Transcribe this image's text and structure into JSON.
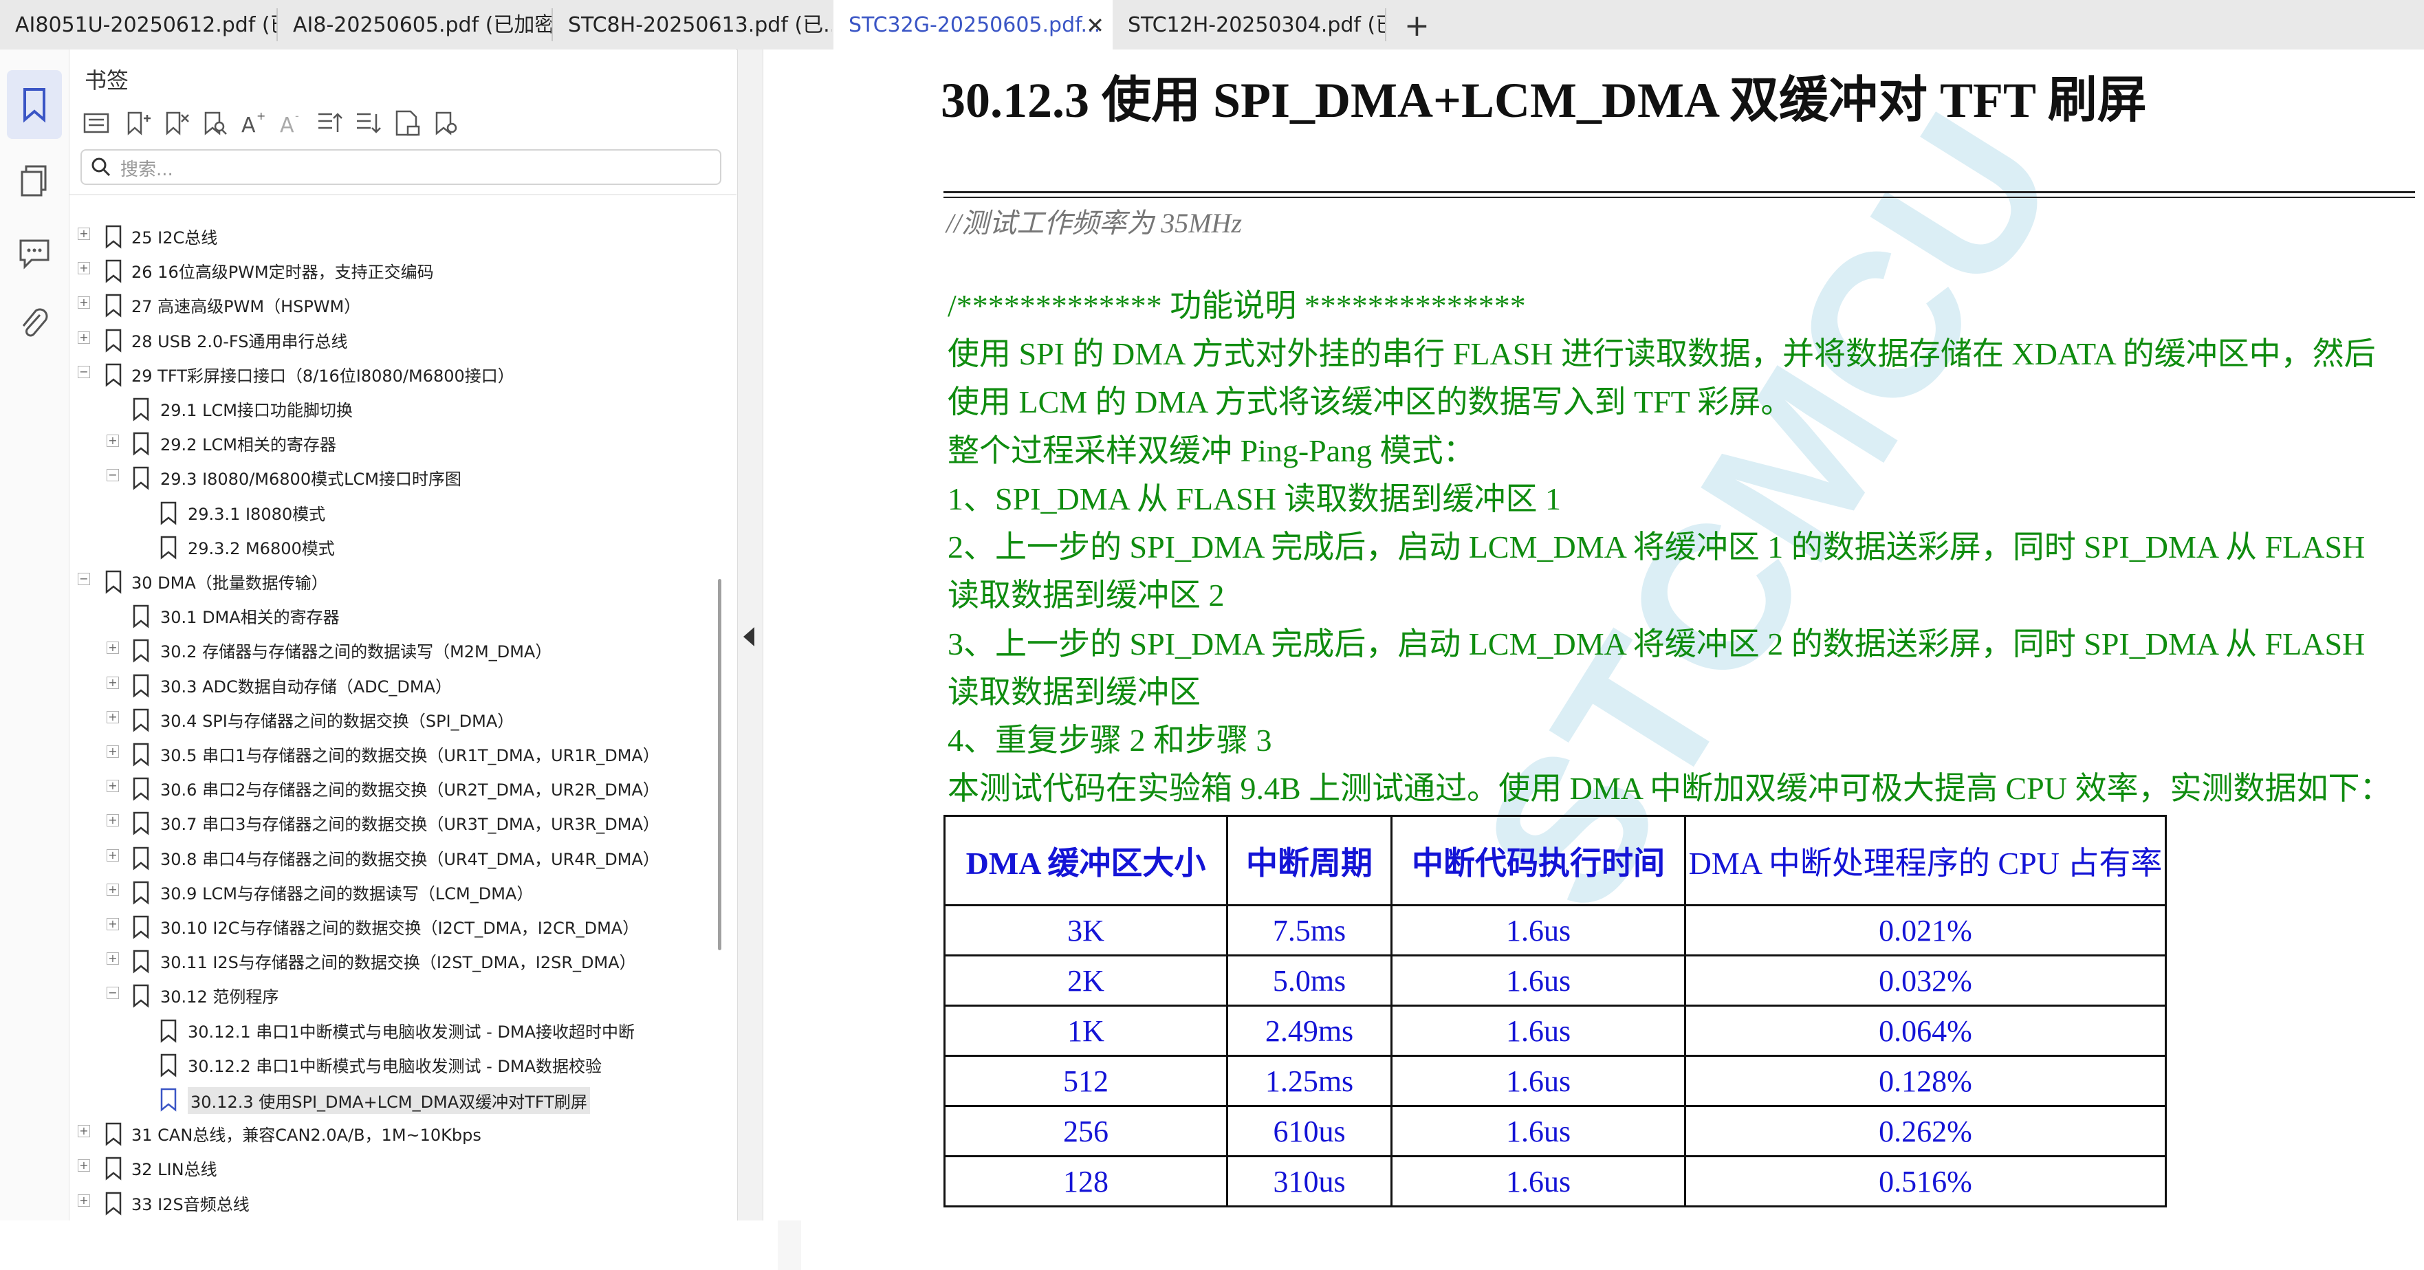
{
  "tabs": [
    {
      "label": "AI8051U-20250612.pdf (已..."
    },
    {
      "label": "AI8-20250605.pdf (已加密)"
    },
    {
      "label": "STC8H-20250613.pdf (已..."
    },
    {
      "label": "STC32G-20250605.pdf...",
      "active": true
    },
    {
      "label": "STC12H-20250304.pdf (已..."
    }
  ],
  "bookmark_panel": {
    "title": "书签",
    "search_placeholder": "搜索..."
  },
  "tree": [
    {
      "label": "25  I2C总线",
      "depth": 0,
      "exp": "+"
    },
    {
      "label": "26  16位高级PWM定时器，支持正交编码",
      "depth": 0,
      "exp": "+"
    },
    {
      "label": "27  高速高级PWM（HSPWM）",
      "depth": 0,
      "exp": "+"
    },
    {
      "label": "28  USB 2.0-FS通用串行总线",
      "depth": 0,
      "exp": "+"
    },
    {
      "label": "29  TFT彩屏接口接口（8/16位I8080/M6800接口）",
      "depth": 0,
      "exp": "-"
    },
    {
      "label": "29.1  LCM接口功能脚切换",
      "depth": 1,
      "exp": ""
    },
    {
      "label": "29.2  LCM相关的寄存器",
      "depth": 1,
      "exp": "+"
    },
    {
      "label": "29.3  I8080/M6800模式LCM接口时序图",
      "depth": 1,
      "exp": "-"
    },
    {
      "label": "29.3.1  I8080模式",
      "depth": 2,
      "exp": ""
    },
    {
      "label": "29.3.2  M6800模式",
      "depth": 2,
      "exp": ""
    },
    {
      "label": "30  DMA（批量数据传输）",
      "depth": 0,
      "exp": "-"
    },
    {
      "label": "30.1  DMA相关的寄存器",
      "depth": 1,
      "exp": ""
    },
    {
      "label": "30.2  存储器与存储器之间的数据读写（M2M_DMA）",
      "depth": 1,
      "exp": "+"
    },
    {
      "label": "30.3  ADC数据自动存储（ADC_DMA）",
      "depth": 1,
      "exp": "+"
    },
    {
      "label": "30.4  SPI与存储器之间的数据交换（SPI_DMA）",
      "depth": 1,
      "exp": "+"
    },
    {
      "label": "30.5  串口1与存储器之间的数据交换（UR1T_DMA，UR1R_DMA）",
      "depth": 1,
      "exp": "+"
    },
    {
      "label": "30.6  串口2与存储器之间的数据交换（UR2T_DMA，UR2R_DMA）",
      "depth": 1,
      "exp": "+"
    },
    {
      "label": "30.7  串口3与存储器之间的数据交换（UR3T_DMA，UR3R_DMA）",
      "depth": 1,
      "exp": "+"
    },
    {
      "label": "30.8  串口4与存储器之间的数据交换（UR4T_DMA，UR4R_DMA）",
      "depth": 1,
      "exp": "+"
    },
    {
      "label": "30.9  LCM与存储器之间的数据读写（LCM_DMA）",
      "depth": 1,
      "exp": "+"
    },
    {
      "label": "30.10  I2C与存储器之间的数据交换（I2CT_DMA，I2CR_DMA）",
      "depth": 1,
      "exp": "+"
    },
    {
      "label": "30.11  I2S与存储器之间的数据交换（I2ST_DMA，I2SR_DMA）",
      "depth": 1,
      "exp": "+"
    },
    {
      "label": "30.12  范例程序",
      "depth": 1,
      "exp": "-"
    },
    {
      "label": "30.12.1 串口1中断模式与电脑收发测试 - DMA接收超时中断",
      "depth": 2,
      "exp": ""
    },
    {
      "label": "30.12.2 串口1中断模式与电脑收发测试 - DMA数据校验",
      "depth": 2,
      "exp": ""
    },
    {
      "label": "30.12.3 使用SPI_DMA+LCM_DMA双缓冲对TFT刷屏",
      "depth": 2,
      "exp": "",
      "selected": true
    },
    {
      "label": "31  CAN总线，兼容CAN2.0A/B，1M~10Kbps",
      "depth": 0,
      "exp": "+"
    },
    {
      "label": "32  LIN总线",
      "depth": 0,
      "exp": "+"
    },
    {
      "label": "33  I2S音频总线",
      "depth": 0,
      "exp": "+"
    }
  ],
  "doc": {
    "heading": "30.12.3    使用 SPI_DMA+LCM_DMA 双缓冲对 TFT 刷屏",
    "watermark": "STCMCU",
    "comment": "//测试工作频率为 35MHz",
    "lines": [
      "/*************    功能说明      **************",
      "使用 SPI 的 DMA 方式对外挂的串行 FLASH 进行读取数据，并将数据存储在 XDATA 的缓冲区中，然后",
      "使用 LCM 的 DMA 方式将该缓冲区的数据写入到 TFT 彩屏。",
      "整个过程采样双缓冲 Ping-Pang 模式：",
      "1、SPI_DMA 从 FLASH 读取数据到缓冲区 1",
      "2、上一步的 SPI_DMA 完成后，启动 LCM_DMA 将缓冲区 1 的数据送彩屏，同时 SPI_DMA 从 FLASH",
      "读取数据到缓冲区 2",
      "3、上一步的 SPI_DMA 完成后，启动 LCM_DMA 将缓冲区 2 的数据送彩屏，同时 SPI_DMA 从 FLASH",
      "读取数据到缓冲区",
      "4、重复步骤 2 和步骤 3",
      "本测试代码在实验箱 9.4B 上测试通过。使用 DMA 中断加双缓冲可极大提高 CPU 效率，实测数据如下："
    ],
    "table": {
      "headers": [
        "DMA 缓冲区大小",
        "中断周期",
        "中断代码执行时间",
        "DMA 中断处理程序的 CPU 占有率"
      ],
      "rows": [
        [
          "3K",
          "7.5ms",
          "1.6us",
          "0.021%"
        ],
        [
          "2K",
          "5.0ms",
          "1.6us",
          "0.032%"
        ],
        [
          "1K",
          "2.49ms",
          "1.6us",
          "0.064%"
        ],
        [
          "512",
          "1.25ms",
          "1.6us",
          "0.128%"
        ],
        [
          "256",
          "610us",
          "1.6us",
          "0.262%"
        ],
        [
          "128",
          "310us",
          "1.6us",
          "0.516%"
        ]
      ]
    },
    "stars": "******************************************************/"
  }
}
